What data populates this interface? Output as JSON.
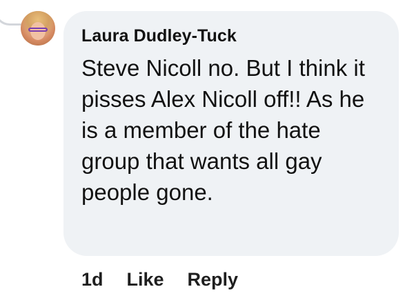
{
  "comment": {
    "author": "Laura Dudley-Tuck",
    "avatar_icon": "profile-photo",
    "text": "Steve Nicoll no. But I think it pisses Alex Nicoll off!! As he is a member of the hate group that wants all gay people gone.",
    "timestamp": "1d",
    "like_label": "Like",
    "reply_label": "Reply"
  },
  "colors": {
    "bubble": "#eff2f5",
    "text": "#121212",
    "thread_line": "#d3d6db",
    "avatar_glasses": "#7a3fb0"
  }
}
